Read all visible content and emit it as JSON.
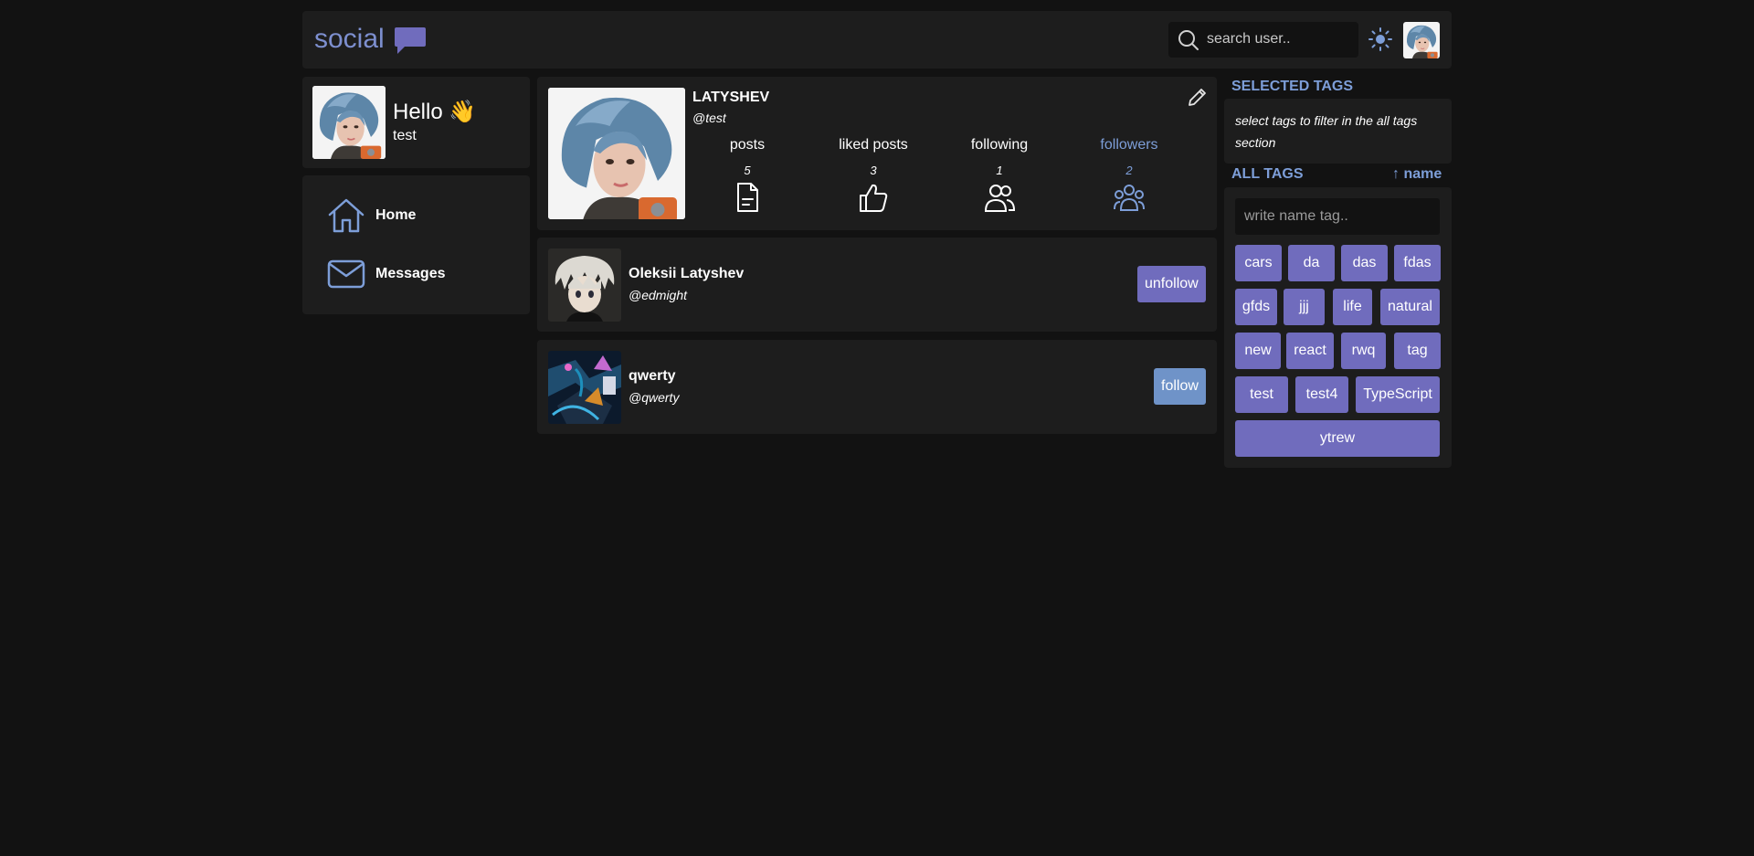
{
  "header": {
    "logo_text": "social",
    "search_placeholder": "search user.."
  },
  "hello": {
    "greeting": "Hello 👋",
    "username": "test"
  },
  "nav": {
    "home_label": "Home",
    "messages_label": "Messages"
  },
  "profile": {
    "name": "LATYSHEV",
    "handle": "@test",
    "stats": [
      {
        "label": "posts",
        "value": "5"
      },
      {
        "label": "liked posts",
        "value": "3"
      },
      {
        "label": "following",
        "value": "1"
      },
      {
        "label": "followers",
        "value": "2"
      }
    ]
  },
  "follows": [
    {
      "name": "Oleksii Latyshev",
      "handle": "@edmight",
      "button": "unfollow"
    },
    {
      "name": "qwerty",
      "handle": "@qwerty",
      "button": "follow"
    }
  ],
  "tags": {
    "selected_title": "SELECTED TAGS",
    "selected_hint": "select tags to filter in the all tags section",
    "all_title": "ALL TAGS",
    "sort_label": "↑ name",
    "input_placeholder": "write name tag..",
    "list": [
      "cars",
      "da",
      "das",
      "fdas",
      "gfds",
      "jjj",
      "life",
      "natural",
      "new",
      "react",
      "rwq",
      "tag",
      "test",
      "test4",
      "TypeScript",
      "ytrew"
    ]
  },
  "colors": {
    "accent": "#706cbd",
    "accent_blue": "#7d9ed8",
    "follow_button": "#6f93c8",
    "panel": "#1d1d1d",
    "background": "#121212"
  }
}
